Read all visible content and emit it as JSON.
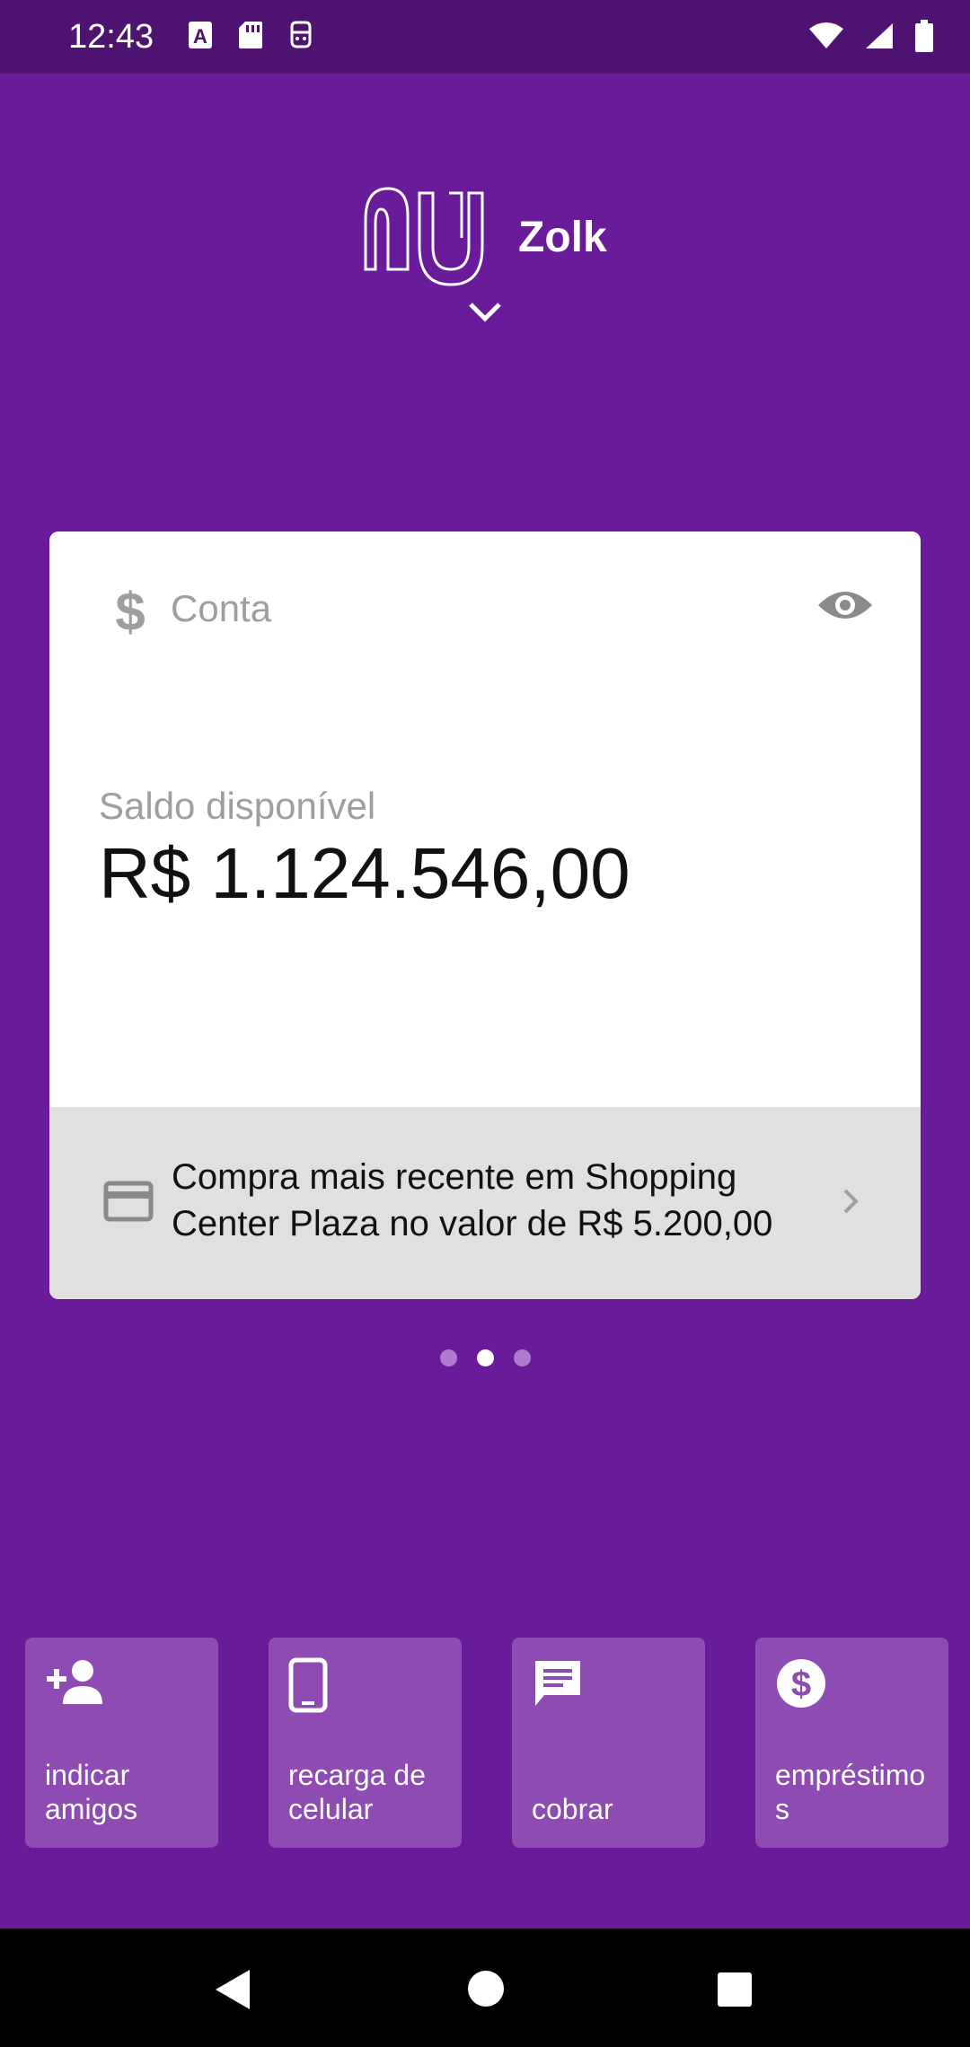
{
  "status_bar": {
    "time": "12:43",
    "left_icons": [
      "font-icon",
      "sd-card-icon",
      "assistant-icon"
    ],
    "right_icons": [
      "wifi-icon",
      "signal-icon",
      "battery-icon"
    ]
  },
  "header": {
    "logo_icon": "nu-logo",
    "profile_name": "Zolk",
    "expand_icon": "chevron-down-icon"
  },
  "account_card": {
    "icon": "dollar-icon",
    "title": "Conta",
    "visibility_icon": "eye-icon",
    "balance_label": "Saldo disponível",
    "balance_value": "R$ 1.124.546,00",
    "recent_icon": "credit-card-icon",
    "recent_purchase": "Compra mais recente em Shopping Center Plaza no valor de R$ 5.200,00"
  },
  "pager": {
    "count": 3,
    "active_index": 1
  },
  "shortcuts": [
    {
      "icon": "person-add-icon",
      "label": "indicar amigos"
    },
    {
      "icon": "phone-icon",
      "label": "recarga de celular"
    },
    {
      "icon": "chat-icon",
      "label": "cobrar"
    },
    {
      "icon": "dollar-circle-icon",
      "label": "empréstimos"
    }
  ],
  "colors": {
    "background": "#6A1B9A",
    "status_bar": "#4E1370",
    "shortcut": "#8E4BB1",
    "card_footer": "#E0E0E0"
  }
}
